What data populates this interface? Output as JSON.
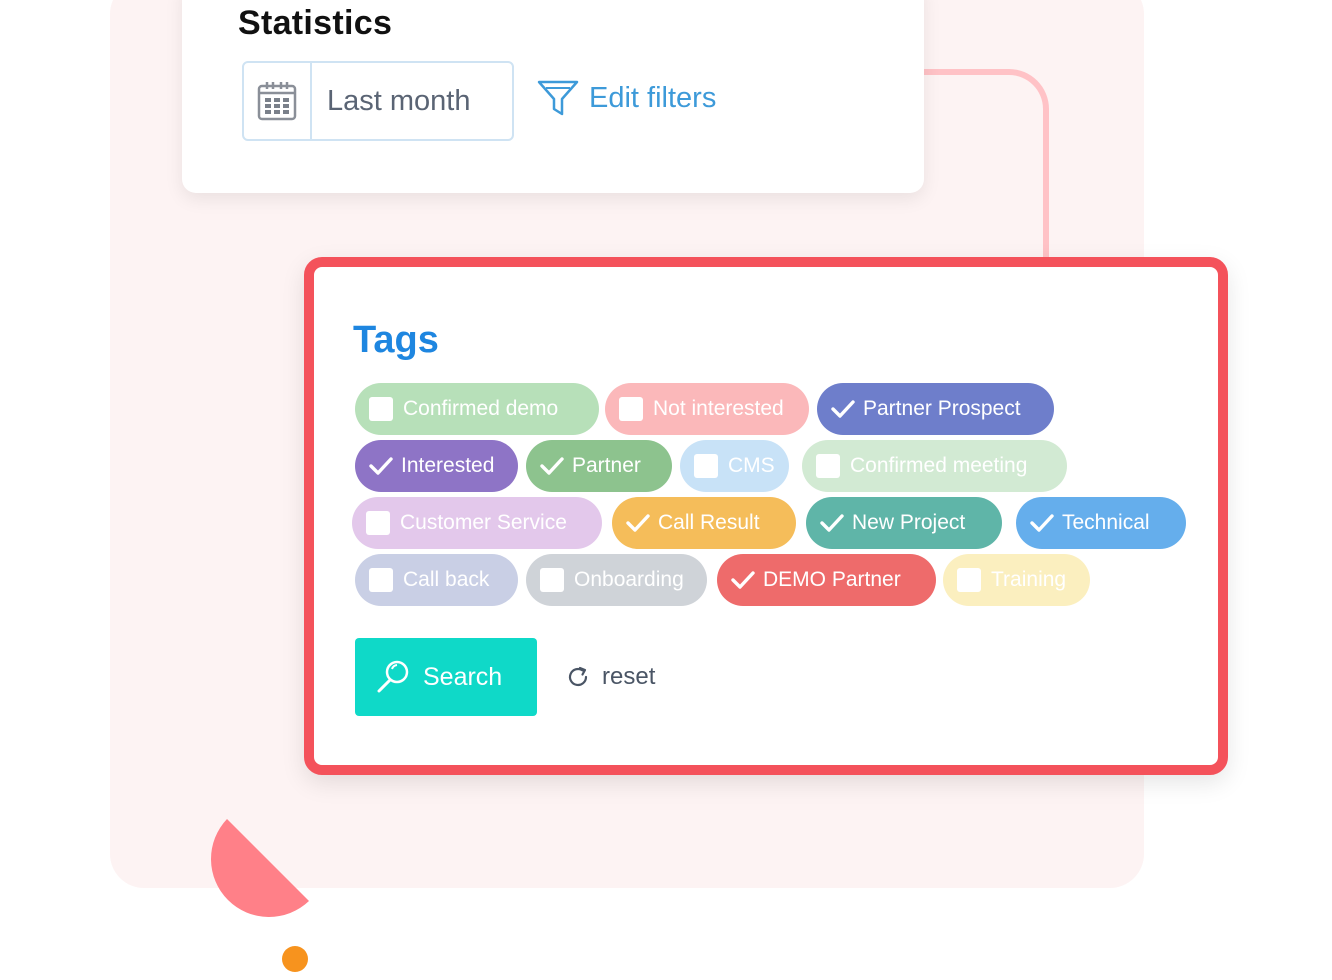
{
  "statistics": {
    "title": "Statistics",
    "date_range": "Last month",
    "edit_filters_label": "Edit filters"
  },
  "tags_panel": {
    "title": "Tags",
    "tags": [
      {
        "label": "Confirmed demo",
        "checked": false,
        "color": "#b7e0b9"
      },
      {
        "label": "Not interested",
        "checked": false,
        "color": "#fbb8ba"
      },
      {
        "label": "Partner Prospect",
        "checked": true,
        "color": "#6e7ecb"
      },
      {
        "label": "Interested",
        "checked": true,
        "color": "#8e74c6"
      },
      {
        "label": "Partner",
        "checked": true,
        "color": "#8dc38e"
      },
      {
        "label": "CMS",
        "checked": false,
        "color": "#c8e2f7"
      },
      {
        "label": "Confirmed meeting",
        "checked": false,
        "color": "#d2ead3"
      },
      {
        "label": "Customer Service",
        "checked": false,
        "color": "#e3c8eb"
      },
      {
        "label": "Call Result",
        "checked": true,
        "color": "#f5bd5a"
      },
      {
        "label": "New Project",
        "checked": true,
        "color": "#5fb5a8"
      },
      {
        "label": "Technical",
        "checked": true,
        "color": "#65aeec"
      },
      {
        "label": "Call back",
        "checked": false,
        "color": "#c9cfe5"
      },
      {
        "label": "Onboarding",
        "checked": false,
        "color": "#cfd3d8"
      },
      {
        "label": "DEMO Partner",
        "checked": true,
        "color": "#ee6b6b"
      },
      {
        "label": "Training",
        "checked": false,
        "color": "#fbefbf"
      }
    ],
    "search_label": "Search",
    "reset_label": "reset"
  },
  "colors": {
    "accent_red": "#f4525b",
    "title_blue": "#1e86e0",
    "search_teal": "#0fd9c8",
    "connector_pink": "#ffc2c6"
  }
}
